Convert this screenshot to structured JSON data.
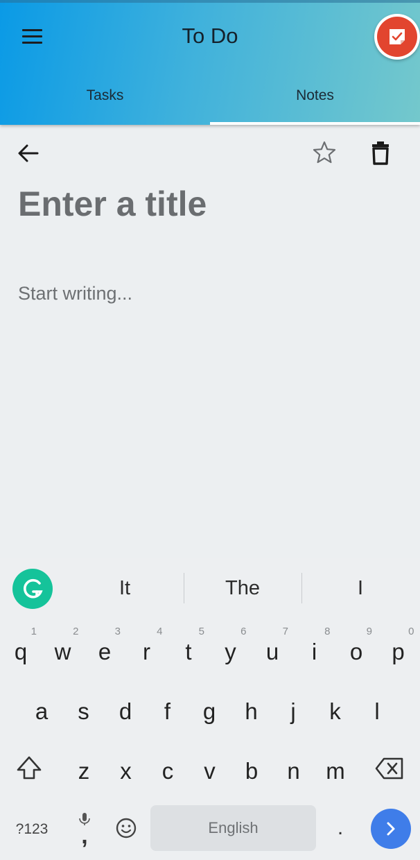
{
  "header": {
    "title": "To Do",
    "menu_icon": "hamburger-menu-icon",
    "logo_icon": "todo-app-logo-icon",
    "tabs": [
      {
        "label": "Tasks",
        "selected": false
      },
      {
        "label": "Notes",
        "selected": true
      }
    ],
    "colors": {
      "gradient_start": "#0a9ae6",
      "gradient_end": "#74c8cc",
      "logo": "#e2452f"
    }
  },
  "note_editor": {
    "back_icon": "arrow-left-icon",
    "star_icon": "star-outline-icon",
    "delete_icon": "trash-icon",
    "title_value": "",
    "title_placeholder": "Enter a title",
    "body_value": "",
    "body_placeholder": "Start writing..."
  },
  "keyboard": {
    "grammarly_icon": "grammarly-icon",
    "suggestions": [
      "It",
      "The",
      "I"
    ],
    "rows": [
      [
        {
          "key": "q",
          "hint": "1"
        },
        {
          "key": "w",
          "hint": "2"
        },
        {
          "key": "e",
          "hint": "3"
        },
        {
          "key": "r",
          "hint": "4"
        },
        {
          "key": "t",
          "hint": "5"
        },
        {
          "key": "y",
          "hint": "6"
        },
        {
          "key": "u",
          "hint": "7"
        },
        {
          "key": "i",
          "hint": "8"
        },
        {
          "key": "o",
          "hint": "9"
        },
        {
          "key": "p",
          "hint": "0"
        }
      ],
      [
        {
          "key": "a"
        },
        {
          "key": "s"
        },
        {
          "key": "d"
        },
        {
          "key": "f"
        },
        {
          "key": "g"
        },
        {
          "key": "h"
        },
        {
          "key": "j"
        },
        {
          "key": "k"
        },
        {
          "key": "l"
        }
      ],
      [
        {
          "key": "z"
        },
        {
          "key": "x"
        },
        {
          "key": "c"
        },
        {
          "key": "v"
        },
        {
          "key": "b"
        },
        {
          "key": "n"
        },
        {
          "key": "m"
        }
      ]
    ],
    "symbols_label": "?123",
    "voice_comma_label": ",",
    "space_label": "English",
    "period_label": ".",
    "shift_icon": "shift-arrow-icon",
    "backspace_icon": "backspace-icon",
    "voice_icon": "microphone-icon",
    "emoji_icon": "emoji-icon",
    "enter_icon": "chevron-right-icon",
    "enter_color": "#3f7de9"
  }
}
